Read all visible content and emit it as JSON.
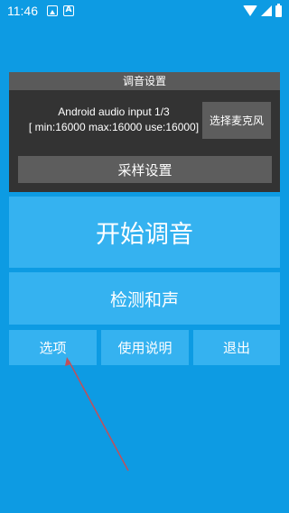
{
  "status_bar": {
    "time": "11:46",
    "icons": [
      "image-icon",
      "font-icon"
    ],
    "right_icons": [
      "wifi-icon",
      "signal-icon",
      "battery-icon"
    ]
  },
  "tuning_settings": {
    "title": "调音设置",
    "device_line1": "Android audio input 1/3",
    "device_line2": "[ min:16000 max:16000 use:16000]",
    "select_mic_label": "选择麦克风",
    "sample_settings_label": "采样设置"
  },
  "main": {
    "start_tuning_label": "开始调音",
    "detect_chord_label": "检测和声"
  },
  "bottom_buttons": {
    "options_label": "选项",
    "help_label": "使用说明",
    "exit_label": "退出"
  },
  "colors": {
    "background": "#0d9be3",
    "button": "#35b2f0",
    "panel": "#333333",
    "panel_header": "#5a5a5a",
    "panel_button": "#5d5d5d",
    "arrow": "#c0505a"
  }
}
